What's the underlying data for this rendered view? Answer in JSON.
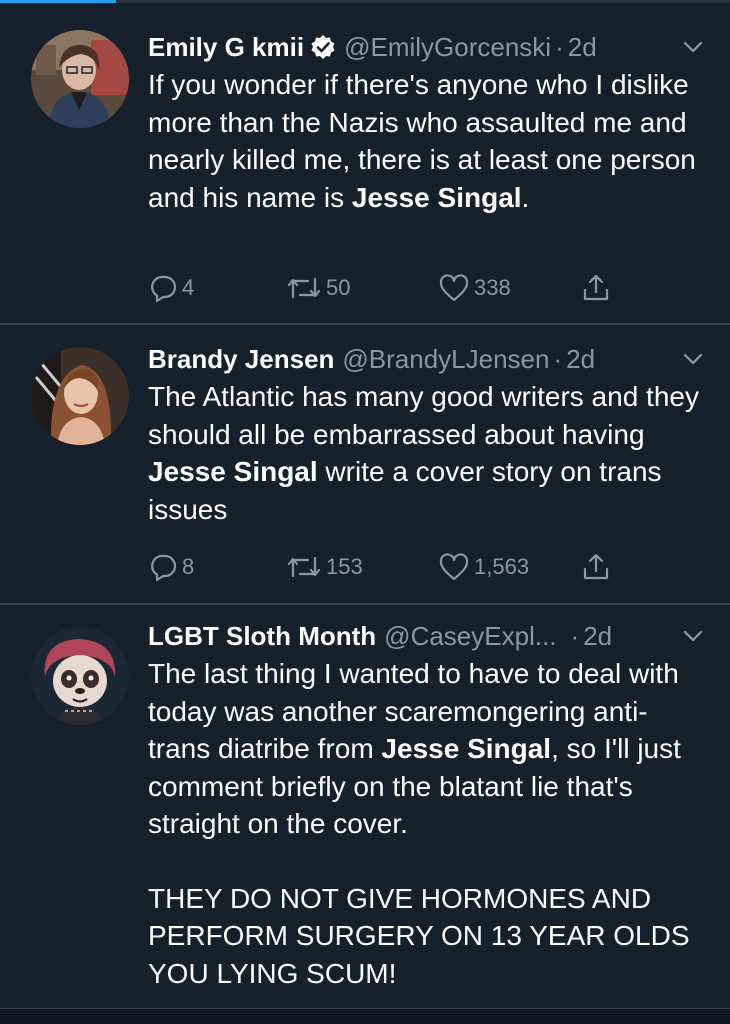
{
  "colors": {
    "background": "#15202b",
    "divider": "#38444d",
    "muted": "#8899a6",
    "accent": "#1da1f2",
    "text": "#ffffff"
  },
  "tweets": [
    {
      "name": "Emily G kmii",
      "verified": true,
      "handle": "@EmilyGorcenski",
      "separator": "·",
      "time": "2d",
      "text_parts": [
        "If you wonder if there's anyone who I dislike more than the Nazis who assaulted me and nearly killed me, there is at least one person and his name is ",
        "Jesse Singal",
        "."
      ],
      "replies": "4",
      "retweets": "50",
      "likes": "338"
    },
    {
      "name": "Brandy Jensen",
      "verified": false,
      "handle": "@BrandyLJensen",
      "separator": "·",
      "time": "2d",
      "text_parts": [
        "The Atlantic has many good writers and they should all be embarrassed about having ",
        "Jesse Singal",
        " write a cover story on trans issues"
      ],
      "replies": "8",
      "retweets": "153",
      "likes": "1,563"
    },
    {
      "name": "LGBT Sloth Month",
      "verified": false,
      "handle": "@CaseyExpl...",
      "separator": "·",
      "time": "2d",
      "text_parts": [
        "The last thing I wanted to have to deal with today was another scaremongering anti-trans diatribe from ",
        "Jesse Singal",
        ", so I'll just comment briefly on the blatant lie that's straight on the cover."
      ],
      "text_extra": "THEY DO NOT GIVE HORMONES AND PERFORM SURGERY ON 13 YEAR OLDS YOU LYING SCUM!"
    }
  ],
  "icons": {
    "reply": "reply-icon",
    "retweet": "retweet-icon",
    "like": "heart-icon",
    "share": "share-icon",
    "menu": "chevron-down-icon",
    "verified": "verified-badge-icon"
  }
}
